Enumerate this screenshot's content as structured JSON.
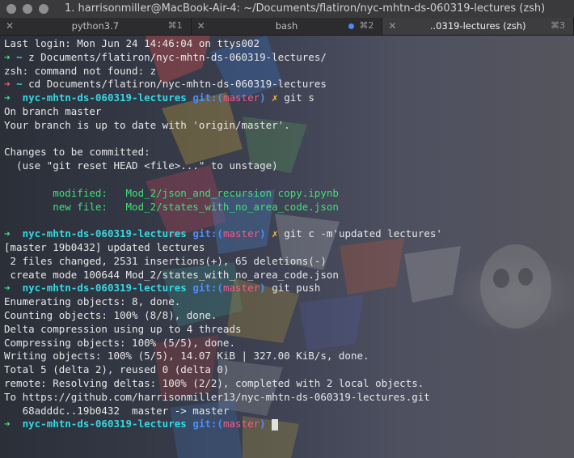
{
  "window": {
    "title": "1. harrisonmiller@MacBook-Air-4: ~/Documents/flatiron/nyc-mhtn-ds-060319-lectures (zsh)"
  },
  "tabs": [
    {
      "label": "python3.7",
      "shortcut": "⌘1",
      "active": false
    },
    {
      "label": "bash",
      "shortcut": "⌘2",
      "active": false
    },
    {
      "label": "..0319-lectures (zsh)",
      "shortcut": "⌘3",
      "active": true
    }
  ],
  "terminal": {
    "prompt_dir": "nyc-mhtn-ds-060319-lectures",
    "prompt_git_open": "git:(",
    "prompt_branch": "master",
    "prompt_git_close": ")",
    "dirty_mark": "✗",
    "arrow": "➜",
    "tilde": "~",
    "lines": [
      {
        "kind": "text",
        "text": "Last login: Mon Jun 24 14:46:04 on ttys002"
      },
      {
        "kind": "home_prompt",
        "arrow": "green",
        "cmd": "z Documents/flatiron/nyc-mhtn-ds-060319-lectures/"
      },
      {
        "kind": "text",
        "text": "zsh: command not found: z"
      },
      {
        "kind": "home_prompt",
        "arrow": "red",
        "cmd": "cd Documents/flatiron/nyc-mhtn-ds-060319-lectures"
      },
      {
        "kind": "repo_prompt",
        "dirty": true,
        "cmd": "git s"
      },
      {
        "kind": "text",
        "text": "On branch master"
      },
      {
        "kind": "text",
        "text": "Your branch is up to date with 'origin/master'."
      },
      {
        "kind": "text",
        "text": ""
      },
      {
        "kind": "text",
        "text": "Changes to be committed:"
      },
      {
        "kind": "text",
        "text": "  (use \"git reset HEAD <file>...\" to unstage)"
      },
      {
        "kind": "text",
        "text": ""
      },
      {
        "kind": "staged",
        "text": "        modified:   Mod_2/json_and_recursion copy.ipynb"
      },
      {
        "kind": "staged",
        "text": "        new file:   Mod_2/states_with_no_area_code.json"
      },
      {
        "kind": "text",
        "text": ""
      },
      {
        "kind": "repo_prompt",
        "dirty": true,
        "cmd": "git c -m'updated lectures'"
      },
      {
        "kind": "text",
        "text": "[master 19b0432] updated lectures"
      },
      {
        "kind": "text",
        "text": " 2 files changed, 2531 insertions(+), 65 deletions(-)"
      },
      {
        "kind": "text",
        "text": " create mode 100644 Mod_2/states_with_no_area_code.json"
      },
      {
        "kind": "repo_prompt",
        "dirty": false,
        "cmd": "git push"
      },
      {
        "kind": "text",
        "text": "Enumerating objects: 8, done."
      },
      {
        "kind": "text",
        "text": "Counting objects: 100% (8/8), done."
      },
      {
        "kind": "text",
        "text": "Delta compression using up to 4 threads"
      },
      {
        "kind": "text",
        "text": "Compressing objects: 100% (5/5), done."
      },
      {
        "kind": "text",
        "text": "Writing objects: 100% (5/5), 14.07 KiB | 327.00 KiB/s, done."
      },
      {
        "kind": "text",
        "text": "Total 5 (delta 2), reused 0 (delta 0)"
      },
      {
        "kind": "text",
        "text": "remote: Resolving deltas: 100% (2/2), completed with 2 local objects."
      },
      {
        "kind": "text",
        "text": "To https://github.com/harrisonmiller13/nyc-mhtn-ds-060319-lectures.git"
      },
      {
        "kind": "text",
        "text": "   68adddc..19b0432  master -> master"
      },
      {
        "kind": "repo_prompt",
        "dirty": false,
        "cmd": "",
        "cursor": true
      }
    ]
  },
  "colors": {
    "prompt_arrow_ok": "#3ee07a",
    "prompt_arrow_err": "#ff5f5f",
    "prompt_dir": "#36d7e2",
    "git_label": "#4f8df8",
    "branch": "#f25c8a",
    "dirty_mark": "#f3c54a",
    "staged": "#3ee07a"
  }
}
